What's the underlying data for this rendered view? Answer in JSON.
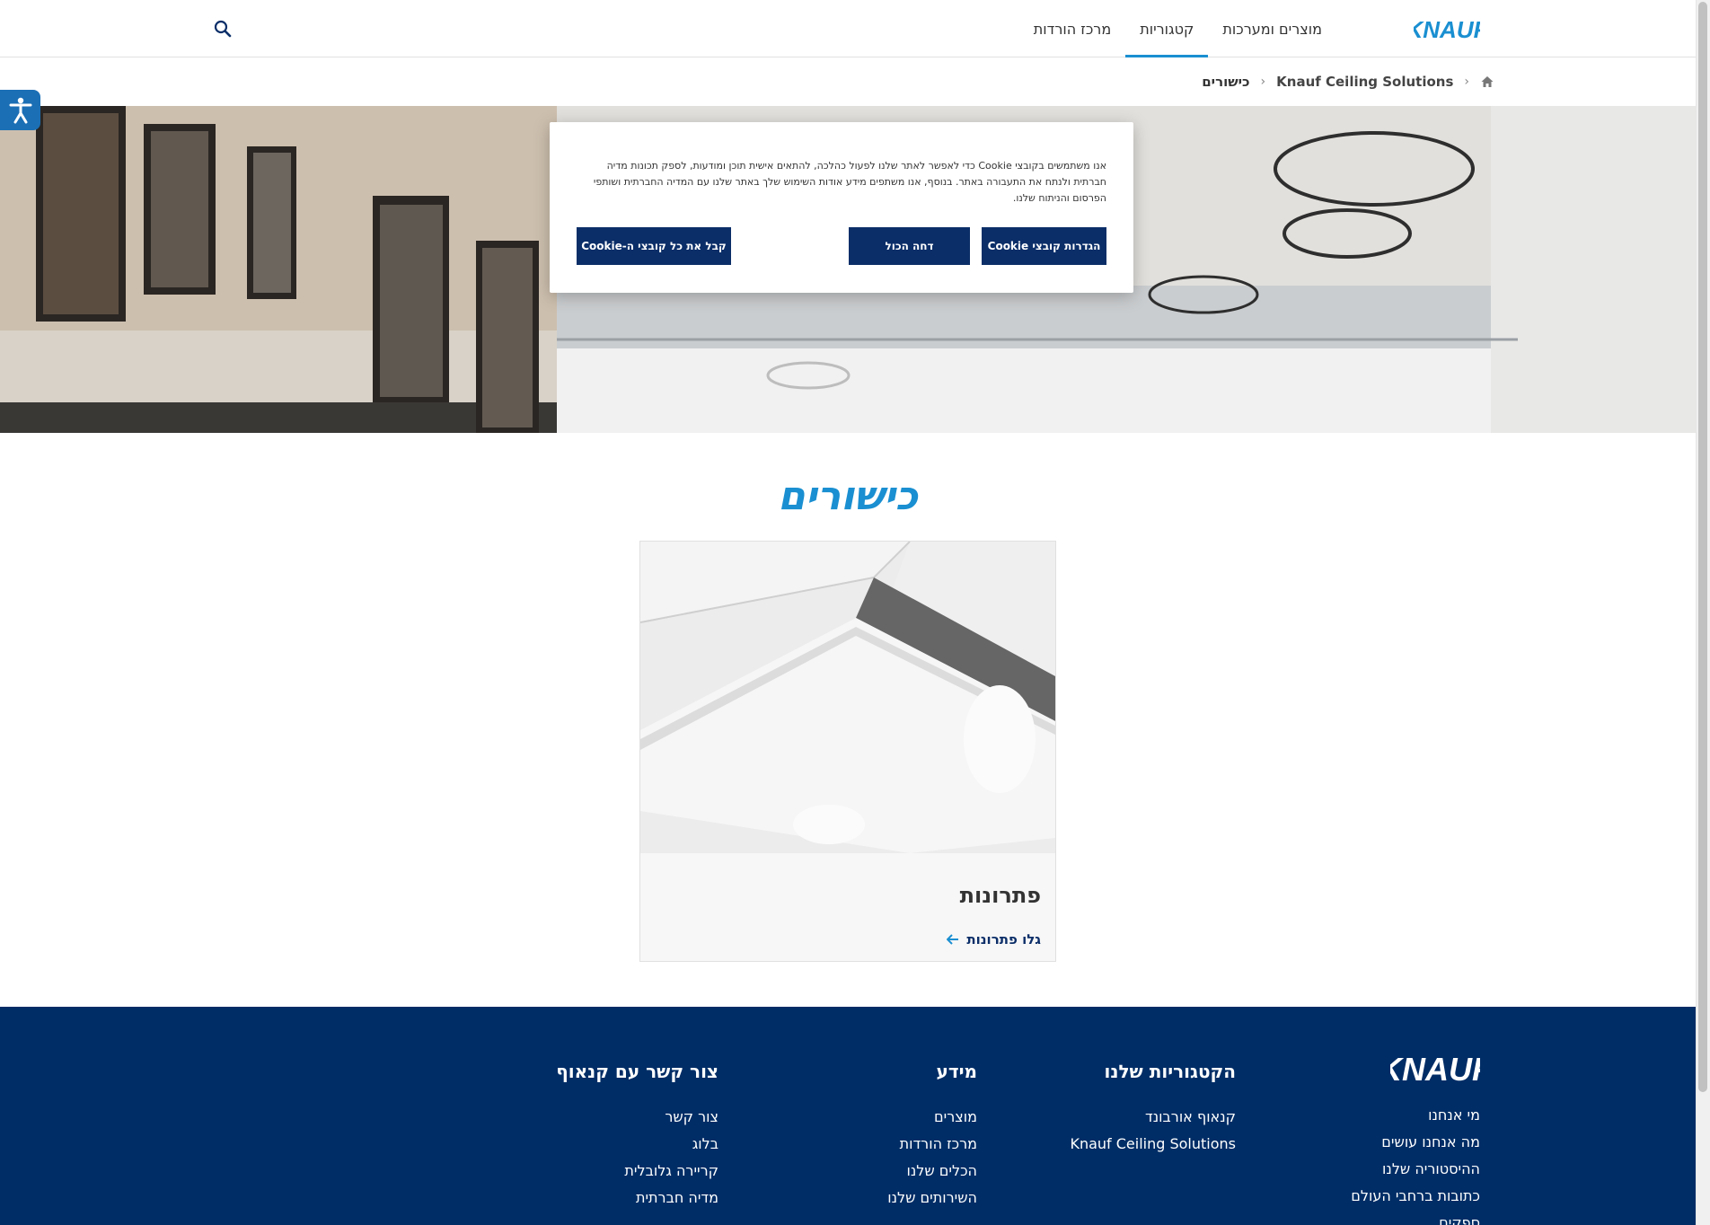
{
  "header": {
    "logo_text": "KNAUF",
    "nav": [
      {
        "label": "מוצרים ומערכות"
      },
      {
        "label": "קטגוריות"
      },
      {
        "label": "מרכז הורדות"
      }
    ],
    "active_nav": "קטגוריות",
    "search_icon": "search-icon"
  },
  "breadcrumb": {
    "home_icon": "home-icon",
    "link": "Knauf Ceiling Solutions",
    "current": "כישורים"
  },
  "cookie": {
    "text": "אנו משתמשים בקובצי Cookie כדי לאפשר לאתר שלנו לפעול כהלכה, להתאים אישית תוכן ומודעות, לספק תכונות מדיה חברתית ולנתח את התעבורה באתר. בנוסף, אנו משתפים מידע אודות השימוש שלך באתר שלנו עם המדיה החברתית ושותפי הפרסום והניתוח שלנו.",
    "settings_label": "הגדרות קובצי Cookie",
    "reject_label": "דחה הכול",
    "accept_label": "קבל את כל קובצי ה-Cookie"
  },
  "page": {
    "title": "כישורים"
  },
  "card": {
    "title": "פתרונות",
    "link_label": "גלו פתרונות"
  },
  "footer": {
    "logo_text": "KNAUF",
    "col1": {
      "items": [
        "מי אנחנו",
        "מה אנחנו עושים",
        "ההיסטוריה שלנו",
        "כתובות ברחבי העולם",
        "ספקים"
      ]
    },
    "col2": {
      "title": "הקטגוריות שלנו",
      "items": [
        "קנאוף אורבונד",
        "Knauf Ceiling Solutions"
      ]
    },
    "col3": {
      "title": "מידע",
      "items": [
        "מוצרים",
        "מרכז הורדות",
        "הכלים שלנו",
        "השירותים שלנו"
      ]
    },
    "col4": {
      "title": "צור קשר עם קנאוף",
      "items": [
        "צור קשר",
        "בלוג",
        "קריירה גלובלית",
        "מדיה חברתית"
      ]
    }
  },
  "colors": {
    "brand_blue": "#1a8fd1",
    "navy": "#0b2e68",
    "footer_bg": "#002d66"
  }
}
